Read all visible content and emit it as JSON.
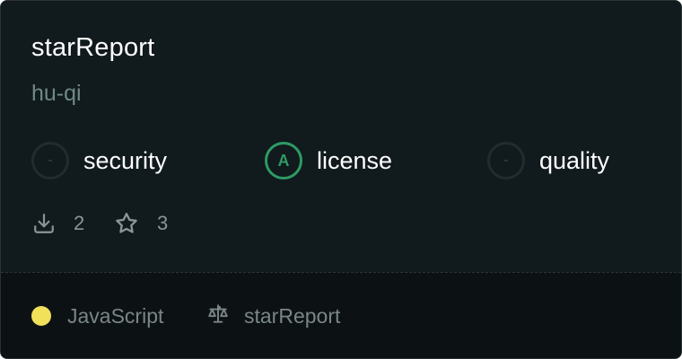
{
  "repo": {
    "name": "starReport",
    "owner": "hu-qi"
  },
  "scores": [
    {
      "label": "security",
      "grade": "-"
    },
    {
      "label": "license",
      "grade": "A"
    },
    {
      "label": "quality",
      "grade": "-"
    }
  ],
  "stats": {
    "downloads": "2",
    "stars": "3"
  },
  "footer": {
    "language": "JavaScript",
    "language_color": "#f1e05a",
    "license_name": "starReport"
  },
  "colors": {
    "grade_a": "#2e9a63",
    "card_bg": "#111a1d"
  }
}
